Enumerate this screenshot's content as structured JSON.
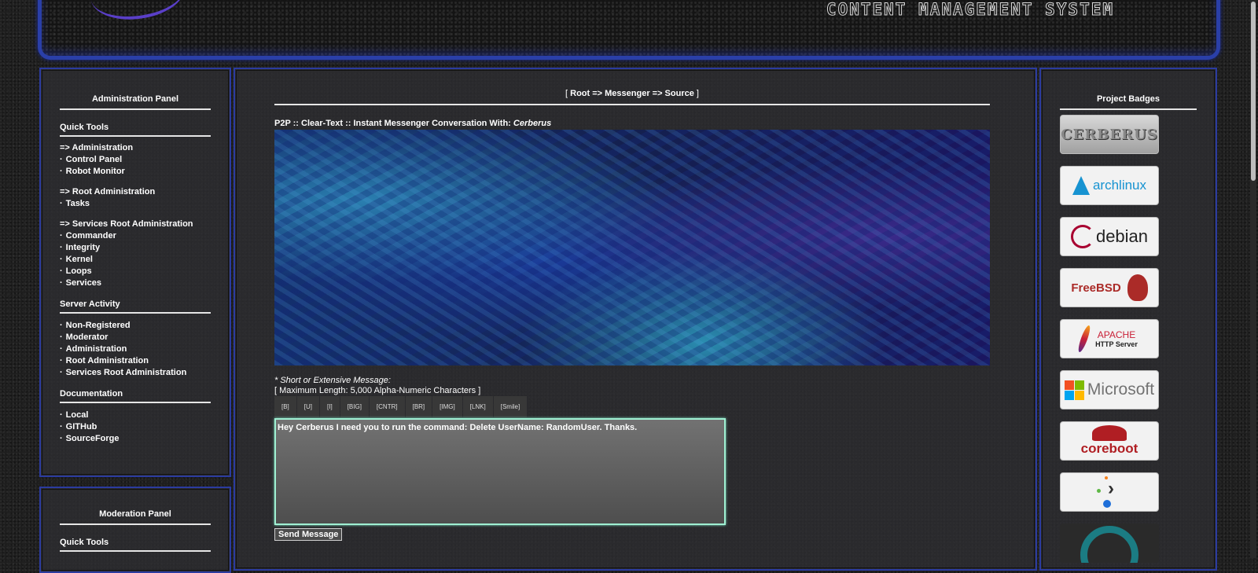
{
  "header": {
    "title": "CONTENT MANAGEMENT SYSTEM"
  },
  "admin_panel": {
    "title": "Administration Panel",
    "quick_tools": "Quick Tools",
    "quick_groups": [
      {
        "group": "=> Administration",
        "items": [
          "Control Panel",
          "Robot Monitor"
        ]
      },
      {
        "group": "=> Root Administration",
        "items": [
          "Tasks"
        ]
      },
      {
        "group": "=> Services Root Administration",
        "items": [
          "Commander",
          "Integrity",
          "Kernel",
          "Loops",
          "Services"
        ]
      }
    ],
    "server_activity": "Server Activity",
    "activity_items": [
      "Non-Registered",
      "Moderator",
      "Administration",
      "Root Administration",
      "Services Root Administration"
    ],
    "documentation": "Documentation",
    "doc_items": [
      "Local",
      "GITHub",
      "SourceForge"
    ]
  },
  "moderation_panel": {
    "title": "Moderation Panel",
    "quick_tools": "Quick Tools"
  },
  "main": {
    "breadcrumb": "Root => Messenger => Source",
    "breadcrumb_open": "[",
    "breadcrumb_close": "]",
    "conversation_label": "P2P :: Clear-Text :: Instant Messenger Conversation With:",
    "conversation_user": "Cerberus",
    "message_hint": "* Short or Extensive Message:",
    "message_limit": "[ Maximum Length: 5,000 Alpha-Numeric Characters ]",
    "format_buttons": [
      "[B]",
      "[U]",
      "[I]",
      "[BIG]",
      "[CNTR]",
      "[BR]",
      "[IMG]",
      "[LNK]",
      "[Smile]"
    ],
    "message_value": "Hey Cerberus I need you to run the command: Delete UserName: RandomUser. Thanks.",
    "send_label": "Send Message"
  },
  "badges": {
    "title": "Project Badges",
    "items": [
      {
        "name": "cerberus",
        "label": "CERBERUS",
        "color": "#888888"
      },
      {
        "name": "archlinux",
        "label": "archlinux",
        "color": "#1793d1"
      },
      {
        "name": "debian",
        "label": "debian",
        "color": "#a80030"
      },
      {
        "name": "freebsd",
        "label": "FreeBSD",
        "color": "#ab2b28"
      },
      {
        "name": "apache",
        "label": "APACHE",
        "sublabel": "HTTP Server",
        "color": "#c92037"
      },
      {
        "name": "microsoft",
        "label": "Microsoft",
        "color": "#737373"
      },
      {
        "name": "coreboot",
        "label": "coreboot",
        "color": "#b01e23"
      },
      {
        "name": "chevron",
        "label": "",
        "color": "#2f2f2f"
      },
      {
        "name": "lamp",
        "label": "",
        "color": "#1b7c83"
      }
    ]
  }
}
